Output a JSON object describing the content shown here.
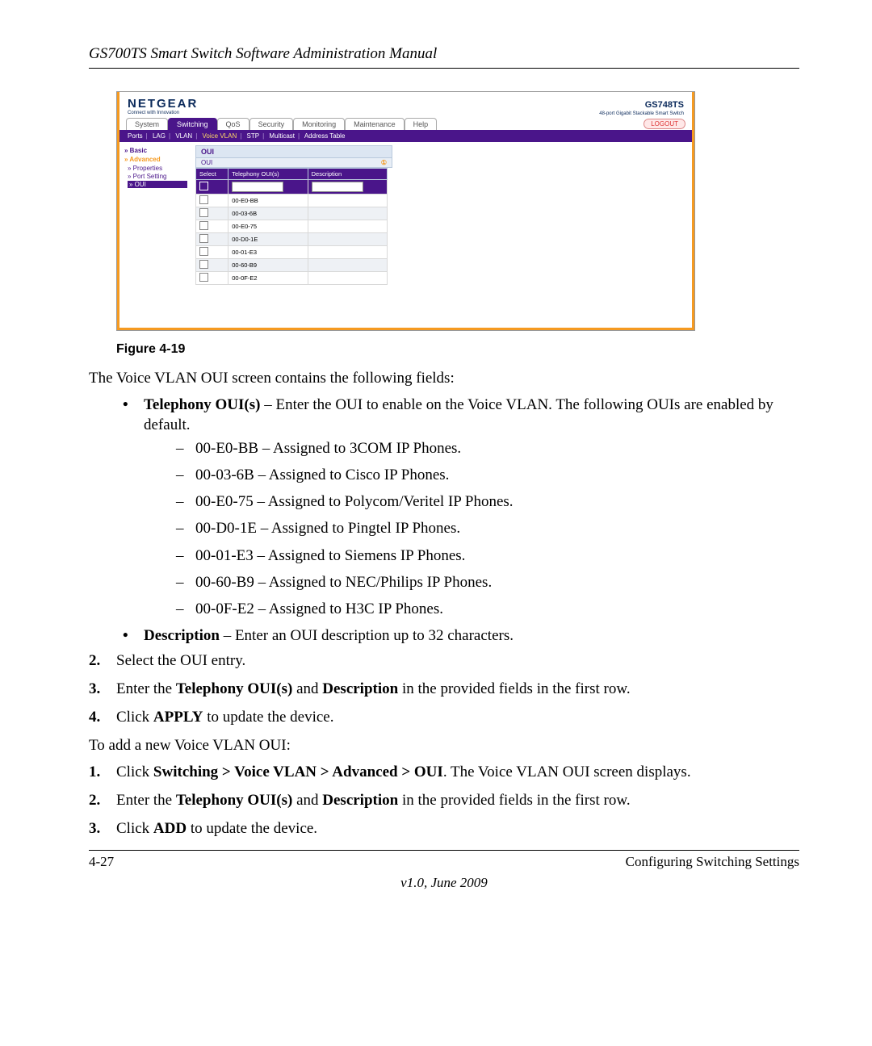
{
  "header": {
    "title": "GS700TS Smart Switch Software Administration Manual"
  },
  "screenshot": {
    "logo": "NETGEAR",
    "logo_sub": "Connect with Innovation",
    "model": "GS748TS",
    "model_sub": "48-port Gigabit Stackable Smart Switch",
    "tabs": [
      "System",
      "Switching",
      "QoS",
      "Security",
      "Monitoring",
      "Maintenance",
      "Help"
    ],
    "active_tab": "Switching",
    "logout": "LOGOUT",
    "subnav": [
      "Ports",
      "LAG",
      "VLAN",
      "Voice VLAN",
      "STP",
      "Multicast",
      "Address Table"
    ],
    "subnav_active": "Voice VLAN",
    "side": {
      "basic": "Basic",
      "advanced": "Advanced",
      "properties": "Properties",
      "port": "Port Setting",
      "oui": "OUI"
    },
    "panel_title": "OUI",
    "panel_sub": "OUI",
    "columns": [
      "Select",
      "Telephony OUI(s)",
      "Description"
    ],
    "rows": [
      "00-E0-BB",
      "00-03-6B",
      "00-E0-75",
      "00-D0-1E",
      "00-01-E3",
      "00-60-B9",
      "00-0F-E2"
    ]
  },
  "caption": "Figure 4-19",
  "intro": "The Voice VLAN OUI screen contains the following fields:",
  "field_tel_label": "Telephony OUI(s)",
  "field_tel_desc": " – Enter the OUI to enable on the Voice VLAN. The following OUIs are enabled by default.",
  "ouis": [
    "00-E0-BB – Assigned to 3COM IP Phones.",
    "00-03-6B – Assigned to Cisco IP Phones.",
    "00-E0-75 – Assigned to Polycom/Veritel IP Phones.",
    "00-D0-1E – Assigned to Pingtel IP Phones.",
    "00-01-E3 – Assigned to Siemens IP Phones.",
    "00-60-B9 – Assigned to NEC/Philips IP Phones.",
    "00-0F-E2 – Assigned to H3C IP Phones."
  ],
  "field_desc_label": "Description",
  "field_desc_desc": " – Enter an OUI description up to 32 characters.",
  "steps_a": {
    "n2": "2.",
    "t2": "Select the OUI entry.",
    "n3": "3.",
    "t3a": "Enter the ",
    "t3b": "Telephony OUI(s)",
    "t3c": " and ",
    "t3d": "Description",
    "t3e": " in the provided fields in the first row.",
    "n4": "4.",
    "t4a": "Click ",
    "t4b": "APPLY",
    "t4c": " to update the device."
  },
  "add_intro": "To add a new Voice VLAN OUI:",
  "steps_b": {
    "n1": "1.",
    "t1a": "Click ",
    "t1b": "Switching > Voice VLAN > Advanced > OUI",
    "t1c": ". The Voice VLAN OUI screen displays.",
    "n2": "2.",
    "t2a": "Enter the ",
    "t2b": "Telephony OUI(s)",
    "t2c": " and ",
    "t2d": "Description",
    "t2e": " in the provided fields in the first row.",
    "n3": "3.",
    "t3a": "Click ",
    "t3b": "ADD",
    "t3c": " to update the device."
  },
  "footer": {
    "left": "4-27",
    "right": "Configuring Switching Settings",
    "center": "v1.0, June 2009"
  }
}
